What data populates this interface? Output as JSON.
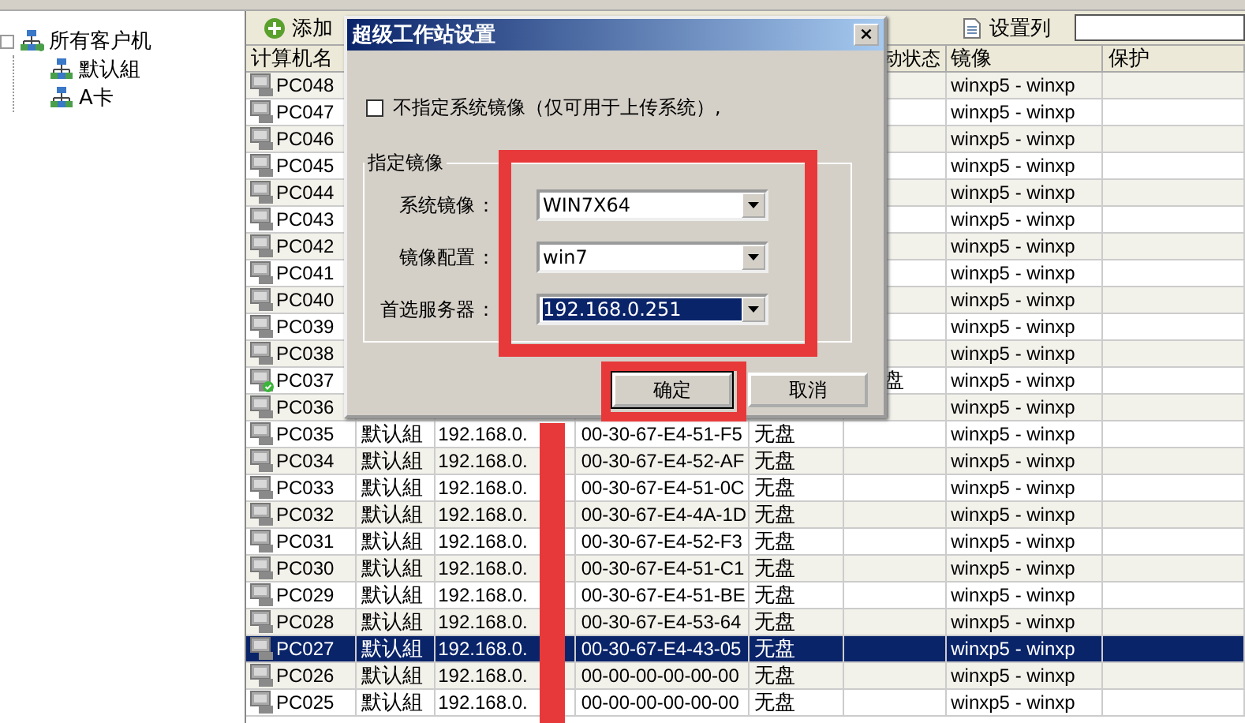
{
  "tree": {
    "label": "所有客户机",
    "expanded": true,
    "children": [
      {
        "label": "默认組"
      },
      {
        "label": "A卡"
      }
    ]
  },
  "toolbar": {
    "items": [
      {
        "label": "添加",
        "kind": "add"
      },
      {
        "label": "设置列",
        "kind": "columns"
      }
    ]
  },
  "table": {
    "header": {
      "name": "计算机名",
      "status": "动状态",
      "image": "镜像",
      "protect": "保护"
    },
    "rows": [
      {
        "name": "PC048",
        "image": "winxp5 - winxp",
        "online": false,
        "selected": false
      },
      {
        "name": "PC047",
        "image": "winxp5 - winxp",
        "online": false,
        "selected": false
      },
      {
        "name": "PC046",
        "image": "winxp5 - winxp",
        "online": false,
        "selected": false
      },
      {
        "name": "PC045",
        "image": "winxp5 - winxp",
        "online": false,
        "selected": false
      },
      {
        "name": "PC044",
        "image": "winxp5 - winxp",
        "online": false,
        "selected": false
      },
      {
        "name": "PC043",
        "image": "winxp5 - winxp",
        "online": false,
        "selected": false
      },
      {
        "name": "PC042",
        "image": "winxp5 - winxp",
        "online": false,
        "selected": false
      },
      {
        "name": "PC041",
        "image": "winxp5 - winxp",
        "online": false,
        "selected": false
      },
      {
        "name": "PC040",
        "image": "winxp5 - winxp",
        "online": false,
        "selected": false
      },
      {
        "name": "PC039",
        "image": "winxp5 - winxp",
        "online": false,
        "selected": false
      },
      {
        "name": "PC038",
        "image": "winxp5 - winxp",
        "online": false,
        "selected": false
      },
      {
        "name": "PC037",
        "status": "盘",
        "image": "winxp5 - winxp",
        "online": true,
        "selected": false
      },
      {
        "name": "PC036",
        "image": "winxp5 - winxp",
        "online": false,
        "selected": false
      },
      {
        "name": "PC035",
        "group": "默认組",
        "ip": "192.168.0.",
        "mac": "00-30-67-E4-51-F5",
        "disk": "无盘",
        "image": "winxp5 - winxp",
        "online": false,
        "selected": false
      },
      {
        "name": "PC034",
        "group": "默认組",
        "ip": "192.168.0.",
        "mac": "00-30-67-E4-52-AF",
        "disk": "无盘",
        "image": "winxp5 - winxp",
        "online": false,
        "selected": false
      },
      {
        "name": "PC033",
        "group": "默认組",
        "ip": "192.168.0.",
        "mac": "00-30-67-E4-51-0C",
        "disk": "无盘",
        "image": "winxp5 - winxp",
        "online": false,
        "selected": false
      },
      {
        "name": "PC032",
        "group": "默认組",
        "ip": "192.168.0.",
        "mac": "00-30-67-E4-4A-1D",
        "disk": "无盘",
        "image": "winxp5 - winxp",
        "online": false,
        "selected": false
      },
      {
        "name": "PC031",
        "group": "默认組",
        "ip": "192.168.0.",
        "mac": "00-30-67-E4-52-F3",
        "disk": "无盘",
        "image": "winxp5 - winxp",
        "online": false,
        "selected": false
      },
      {
        "name": "PC030",
        "group": "默认組",
        "ip": "192.168.0.",
        "mac": "00-30-67-E4-51-C1",
        "disk": "无盘",
        "image": "winxp5 - winxp",
        "online": false,
        "selected": false
      },
      {
        "name": "PC029",
        "group": "默认組",
        "ip": "192.168.0.",
        "mac": "00-30-67-E4-51-BE",
        "disk": "无盘",
        "image": "winxp5 - winxp",
        "online": false,
        "selected": false
      },
      {
        "name": "PC028",
        "group": "默认組",
        "ip": "192.168.0.",
        "mac": "00-30-67-E4-53-64",
        "disk": "无盘",
        "image": "winxp5 - winxp",
        "online": false,
        "selected": false
      },
      {
        "name": "PC027",
        "group": "默认組",
        "ip": "192.168.0.",
        "mac": "00-30-67-E4-43-05",
        "disk": "无盘",
        "image": "winxp5 - winxp",
        "online": false,
        "selected": true
      },
      {
        "name": "PC026",
        "group": "默认組",
        "ip": "192.168.0.",
        "mac": "00-00-00-00-00-00",
        "disk": "无盘",
        "image": "winxp5 - winxp",
        "online": false,
        "selected": false
      },
      {
        "name": "PC025",
        "group": "默认組",
        "ip": "192.168.0.",
        "mac": "00-00-00-00-00-00",
        "disk": "无盘",
        "image": "winxp5 - winxp",
        "online": false,
        "selected": false
      }
    ]
  },
  "dialog": {
    "title": "超级工作站设置",
    "close": "×",
    "checkbox": {
      "label": "不指定系统镜像（仅可用于上传系统）,",
      "checked": false
    },
    "group": {
      "title": "指定镜像",
      "fields": [
        {
          "label": "系统镜像",
          "colon": "：",
          "value": "WIN7X64",
          "selected": false
        },
        {
          "label": "镜像配置",
          "colon": "：",
          "value": "win7",
          "selected": false
        },
        {
          "label": "首选服务器",
          "colon": "：",
          "value": "192.168.0.251",
          "selected": true
        }
      ]
    },
    "buttons": [
      {
        "label": "确定",
        "default": true
      },
      {
        "label": "取消",
        "default": false
      }
    ]
  }
}
